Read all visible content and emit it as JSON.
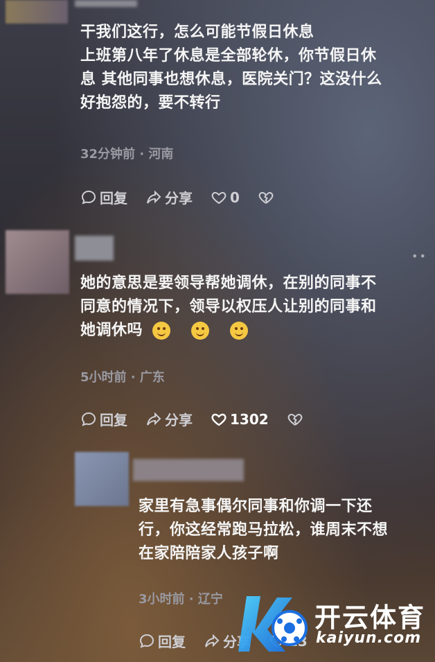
{
  "comments": [
    {
      "text_lines": [
        "干我们这行，怎么可能节假日休息",
        "上班第八年了休息是全部轮休，你节假日休",
        "息 其他同事也想休息，医院关门？这没什么",
        "好抱怨的，要不转行"
      ],
      "meta": "32分钟前 · 河南",
      "reply_label": "回复",
      "share_label": "分享",
      "like_count": "0"
    },
    {
      "text_lines": [
        "她的意思是要领导帮她调休，在别的同事不",
        "同意的情况下，领导以权压人让别的同事和",
        "她调休吗"
      ],
      "meta": "5小时前 · 广东",
      "reply_label": "回复",
      "share_label": "分享",
      "like_count": "1302"
    },
    {
      "text_lines": [
        "家里有急事偶尔同事和你调一下还",
        "行，你这经常跑马拉松，谁周末不想",
        "在家陪陪家人孩子啊"
      ],
      "meta": "3小时前 · 辽宁",
      "reply_label": "回复",
      "share_label": "分享",
      "like_count": "13"
    }
  ],
  "watermark": {
    "brand": "开云体育",
    "domain": "kaiyun.com"
  }
}
